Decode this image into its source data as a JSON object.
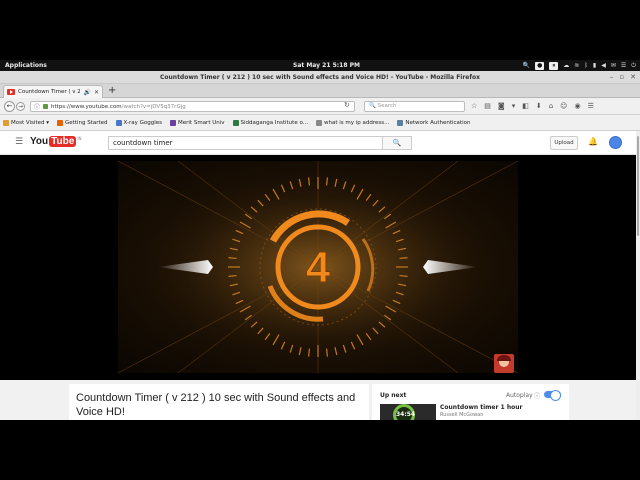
{
  "system_bar": {
    "applications": "Applications",
    "datetime": "Sat May 21  5:18 PM"
  },
  "window": {
    "title": "Countdown Timer ( v 212 ) 10 sec with Sound effects and Voice HD! - YouTube - Mozilla Firefox"
  },
  "tab": {
    "label": "Countdown Timer ( v 2..."
  },
  "navbar": {
    "url_domain": "https://www.youtube.com",
    "url_path": "/watch?v=jDV5q37rGjg",
    "search_placeholder": "Search"
  },
  "bookmarks": [
    {
      "label": "Most Visited ▾",
      "icon": "gear-icon"
    },
    {
      "label": "Getting Started",
      "icon": "firefox-icon"
    },
    {
      "label": "X-ray Goggles",
      "icon": "goggles-icon"
    },
    {
      "label": "Merit Smart Univ",
      "icon": "merit-icon"
    },
    {
      "label": "Siddaganga Institute o...",
      "icon": "institute-icon"
    },
    {
      "label": "what is my ip address...",
      "icon": "web-icon"
    },
    {
      "label": "Network Authentication",
      "icon": "network-icon"
    }
  ],
  "youtube": {
    "logo_you": "You",
    "logo_tube": "Tube",
    "logo_region": "IN",
    "search_value": "countdown timer",
    "upload_label": "Upload",
    "video": {
      "countdown_digit": "4",
      "title": "Countdown Timer ( v 212 ) 10 sec with Sound effects and Voice HD!"
    },
    "up_next": {
      "heading": "Up next",
      "autoplay_label": "Autoplay",
      "autoplay_on": true,
      "next_title": "Countdown timer 1 hour",
      "next_channel": "Russell McGowan",
      "next_thumb_text": "34:54"
    }
  },
  "colors": {
    "accent_orange": "#f08a1c",
    "youtube_red": "#e52d27",
    "toggle_blue": "#4f8ee8"
  }
}
